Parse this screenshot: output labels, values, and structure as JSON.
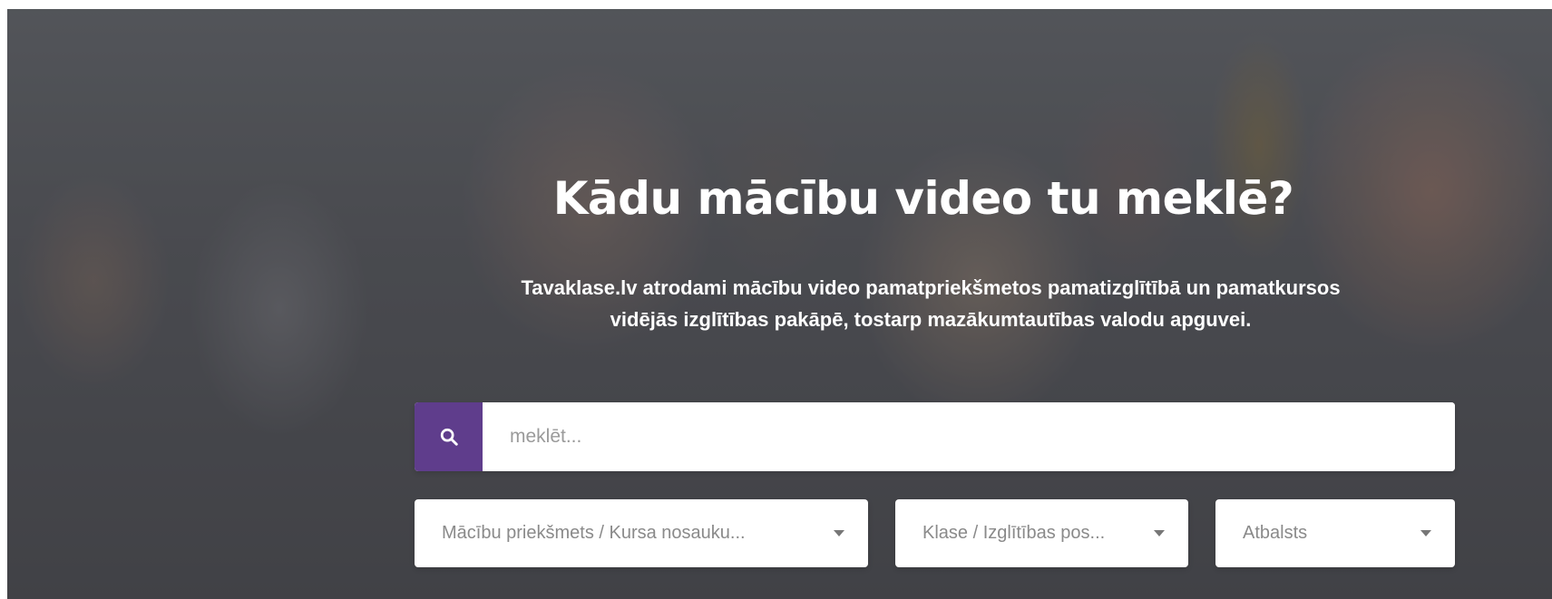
{
  "hero": {
    "title": "Kādu mācību video tu meklē?",
    "subtitle_line1": "Tavaklase.lv atrodami mācību video pamatpriekšmetos pamatizglītībā un pamatkursos",
    "subtitle_line2": "vidējās izglītības pakāpē, tostarp mazākumtautības valodu apguvei."
  },
  "search": {
    "placeholder": "meklēt...",
    "button_icon": "search-icon",
    "accent_color": "#5f3d8c"
  },
  "filters": {
    "subject": "Mācību priekšmets / Kursa nosauku...",
    "class": "Klase / Izglītības pos...",
    "support": "Atbalsts"
  }
}
